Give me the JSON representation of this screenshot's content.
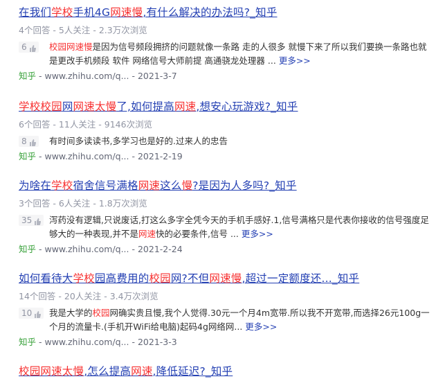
{
  "results": [
    {
      "title_parts": [
        {
          "t": "在我们",
          "hl": false
        },
        {
          "t": "学校",
          "hl": true
        },
        {
          "t": "手机4G",
          "hl": false
        },
        {
          "t": "网速慢",
          "hl": true
        },
        {
          "t": ",有什么解决的办法吗?_知乎",
          "hl": false
        }
      ],
      "stats": "4个回答 - 5人关注 - 2.3万次浏览",
      "votes": "6",
      "answer_parts": [
        {
          "t": "校园网速慢",
          "hl": true
        },
        {
          "t": "是因为信号频段拥挤的问题就像一条路 走的人很多 就慢下来了所以我们要换一条路也就是更改手机频段 软件 网络信号大师前提 高通骁龙处理器 ...",
          "hl": false
        }
      ],
      "more": "更多>>",
      "source_site": "知乎",
      "source_url": " - www.zhihu.com/q... - 2021-3-7"
    },
    {
      "title_parts": [
        {
          "t": "学校校园",
          "hl": true
        },
        {
          "t": "网",
          "hl": false
        },
        {
          "t": "网速太慢",
          "hl": true
        },
        {
          "t": "了,如何提高",
          "hl": false
        },
        {
          "t": "网速",
          "hl": true
        },
        {
          "t": ",想安心玩游戏?_知乎",
          "hl": false
        }
      ],
      "stats": "6个回答 - 11人关注 - 9146次浏览",
      "votes": "8",
      "answer_parts": [
        {
          "t": "有时间多读读书,多学习也是好的.过来人的忠告",
          "hl": false
        }
      ],
      "more": "",
      "source_site": "知乎",
      "source_url": " - www.zhihu.com/q... - 2021-2-19"
    },
    {
      "title_parts": [
        {
          "t": "为啥在",
          "hl": false
        },
        {
          "t": "学校",
          "hl": true
        },
        {
          "t": "宿舍信号满格",
          "hl": false
        },
        {
          "t": "网速",
          "hl": true
        },
        {
          "t": "这么",
          "hl": false
        },
        {
          "t": "慢",
          "hl": true
        },
        {
          "t": "?是因为人多吗?_知乎",
          "hl": false
        }
      ],
      "stats": "3个回答 - 6人关注 - 1.8万次浏览",
      "votes": "35",
      "answer_parts": [
        {
          "t": "泻药没有逻辑,只说废话,打这么多字全凭今天的手机手感好.1,信号满格只是代表你接收的信号强度足够大的一种表现,并不是",
          "hl": false
        },
        {
          "t": "网速",
          "hl": true
        },
        {
          "t": "快的必要条件,信号 ...",
          "hl": false
        }
      ],
      "more": "更多>>",
      "source_site": "知乎",
      "source_url": " - www.zhihu.com/q... - 2021-2-24"
    },
    {
      "title_parts": [
        {
          "t": "如何看待大",
          "hl": false
        },
        {
          "t": "学校",
          "hl": true
        },
        {
          "t": "园高费用的",
          "hl": false
        },
        {
          "t": "校园",
          "hl": true
        },
        {
          "t": "网?不但",
          "hl": false
        },
        {
          "t": "网速慢",
          "hl": true
        },
        {
          "t": ",超过一定额度还..._知乎",
          "hl": false
        }
      ],
      "stats": "14个回答 - 20人关注 - 3.4万次浏览",
      "votes": "10",
      "answer_parts": [
        {
          "t": "我是大学的",
          "hl": false
        },
        {
          "t": "校园",
          "hl": true
        },
        {
          "t": "网确实贵且慢,我个人觉得.30元一个月4m宽带.所以我不开宽带,而选择26元100g一个月的流量卡.(手机开WiFi给电脑)起码4g网络网...",
          "hl": false
        }
      ],
      "more": "更多>>",
      "source_site": "知乎",
      "source_url": " - www.zhihu.com/q... - 2021-3-3"
    },
    {
      "title_parts": [
        {
          "t": "校园网速太慢",
          "hl": true
        },
        {
          "t": ",怎么提高",
          "hl": false
        },
        {
          "t": "网速",
          "hl": true
        },
        {
          "t": ",降低延迟?_知乎",
          "hl": false
        }
      ],
      "stats": "",
      "votes": "",
      "answer_parts": [],
      "more": "",
      "source_site": "",
      "source_url": ""
    }
  ]
}
